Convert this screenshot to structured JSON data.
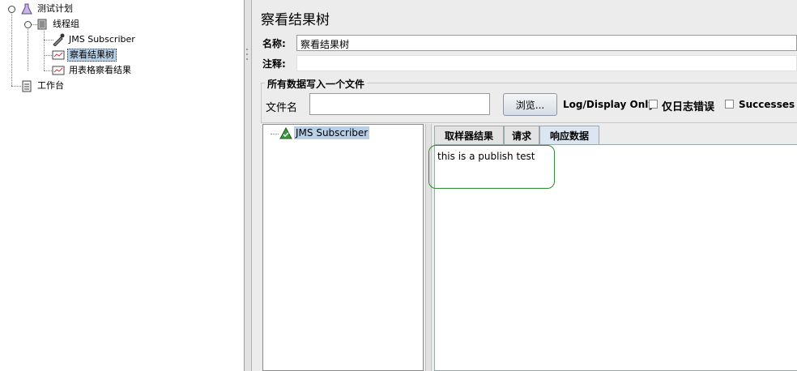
{
  "tree": {
    "root_label": "测试计划",
    "thread_group_label": "线程组",
    "sampler_label": "JMS Subscriber",
    "listener1_label": "察看结果树",
    "listener2_label": "用表格察看结果",
    "workbench_label": "工作台"
  },
  "panel": {
    "title": "察看结果树",
    "name_label": "名称:",
    "name_value": "察看结果树",
    "comment_label": "注释:",
    "comment_value": "",
    "file_group_title": "所有数据写入一个文件",
    "filename_label": "文件名",
    "filename_value": "",
    "browse_button": "浏览...",
    "log_display_label": "Log/Display Only:",
    "errors_only_label": "仅日志错误",
    "successes_label": "Successes"
  },
  "results": {
    "tree_item": "JMS Subscriber",
    "tabs": [
      "取样器结果",
      "请求",
      "响应数据"
    ],
    "active_tab": 2,
    "response_text": "this is a publish test"
  },
  "colors": {
    "selection": "#b8cfe5",
    "success_icon": "#3a9a3a",
    "highlight_outline": "#2e8b2e"
  }
}
